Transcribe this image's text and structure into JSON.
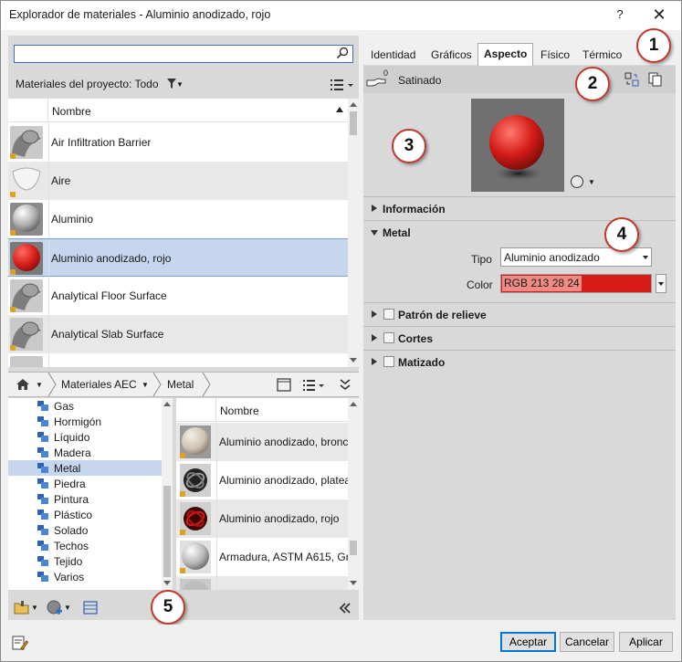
{
  "window": {
    "title": "Explorador de materiales - Aluminio anodizado, rojo",
    "help_glyph": "?",
    "close_glyph": "✕"
  },
  "search": {
    "value": "",
    "placeholder": ""
  },
  "project": {
    "filter_label": "Materiales del proyecto: Todo",
    "column_name": "Nombre",
    "rows": [
      {
        "name": "Air Infiltration Barrier"
      },
      {
        "name": "Aire"
      },
      {
        "name": "Aluminio"
      },
      {
        "name": "Aluminio anodizado, rojo"
      },
      {
        "name": "Analytical Floor Surface"
      },
      {
        "name": "Analytical Slab Surface"
      }
    ]
  },
  "library": {
    "breadcrumb": [
      "Materiales AEC",
      "Metal"
    ],
    "tree": [
      "Gas",
      "Hormigón",
      "Líquido",
      "Madera",
      "Metal",
      "Piedra",
      "Pintura",
      "Plástico",
      "Solado",
      "Techos",
      "Tejido",
      "Varios"
    ],
    "selected_tree_item": "Metal",
    "column_name": "Nombre",
    "rows": [
      {
        "name": "Aluminio anodizado, bronc"
      },
      {
        "name": "Aluminio anodizado, platea"
      },
      {
        "name": "Aluminio anodizado, rojo"
      },
      {
        "name": "Armadura, ASTM A615, Gra"
      }
    ]
  },
  "tabs": [
    "Identidad",
    "Gráficos",
    "Aspecto",
    "Físico",
    "Térmico"
  ],
  "active_tab": "Aspecto",
  "asset": {
    "name": "Satinado",
    "count": "0"
  },
  "sections": {
    "info": "Información",
    "metal": "Metal",
    "relief": "Patrón de relieve",
    "cuts": "Cortes",
    "tint": "Matizado"
  },
  "properties": {
    "type_label": "Tipo",
    "type_value": "Aluminio anodizado",
    "color_label": "Color",
    "color_value": "RGB 213 28 24",
    "color_hex": "#d51c18"
  },
  "callouts": [
    "1",
    "2",
    "3",
    "4",
    "5"
  ],
  "buttons": {
    "ok": "Aceptar",
    "cancel": "Cancelar",
    "apply": "Aplicar"
  },
  "colors": {
    "selection": "#c5d6ee",
    "accent": "#0078d7",
    "callout_border": "#c0392b"
  }
}
